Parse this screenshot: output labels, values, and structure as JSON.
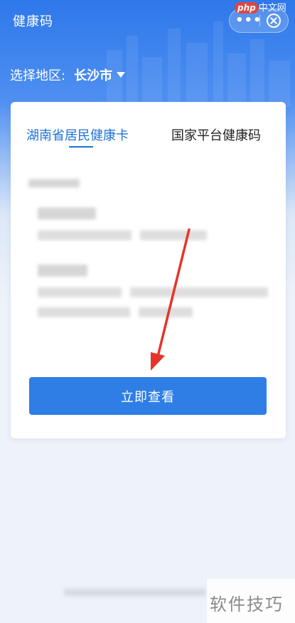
{
  "header": {
    "title": "健康码",
    "more_icon": "more-dots-icon",
    "close_icon": "close-circle-icon"
  },
  "watermark_top": {
    "logo": "php",
    "text": "中文网"
  },
  "region": {
    "label": "选择地区:",
    "value": "长沙市",
    "caret_icon": "caret-down-icon"
  },
  "tabs": [
    {
      "label": "湖南省居民健康卡",
      "active": true
    },
    {
      "label": "国家平台健康码",
      "active": false
    }
  ],
  "button": {
    "label": "立即查看"
  },
  "watermark_bottom": {
    "text": "软件技巧"
  },
  "colors": {
    "primary": "#2e7ee6",
    "header_blue": "#2f78ea",
    "tab_active": "#1f72d6",
    "arrow": "#e5352b"
  }
}
